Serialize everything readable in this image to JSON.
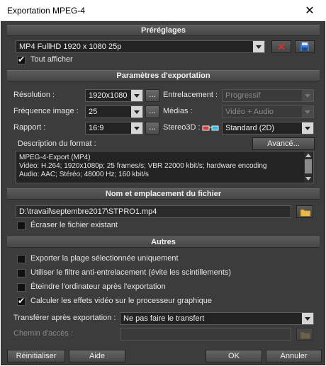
{
  "window": {
    "title": "Exportation MPEG-4",
    "close_glyph": "✕"
  },
  "presets": {
    "header": "Préréglages",
    "selected": "MP4 FullHD 1920 x 1080 25p",
    "show_all_label": "Tout afficher",
    "show_all_checked": true
  },
  "export_params": {
    "header": "Paramètres d'exportation",
    "resolution_label": "Résolution :",
    "resolution_value": "1920x1080",
    "framerate_label": "Fréquence image :",
    "framerate_value": "25",
    "ratio_label": "Rapport :",
    "ratio_value": "16:9",
    "interlace_label": "Entrelacement :",
    "interlace_value": "Progressif",
    "media_label": "Médias :",
    "media_value": "Vidéo + Audio",
    "stereo_label": "Stereo3D :",
    "stereo_value": "Standard (2D)",
    "more_glyph": "...",
    "format_desc_label": "Description du format :",
    "advanced_label": "Avancé...",
    "format_desc_lines": [
      "MPEG-4-Export (MP4)",
      "Video: H.264; 1920x1080p; 25 frames/s; VBR 22000 kbit/s; hardware encoding",
      "Audio: AAC; Stéréo; 48000 Hz; 160 kbit/s"
    ]
  },
  "file": {
    "header": "Nom et emplacement du fichier",
    "path": "D:\\travail\\septembre2017\\STPRO1.mp4",
    "overwrite_label": "Écraser le fichier existant",
    "overwrite_checked": false
  },
  "other": {
    "header": "Autres",
    "options": [
      {
        "label": "Exporter la plage sélectionnée uniquement",
        "checked": false
      },
      {
        "label": "Utiliser le filtre anti-entrelacement (évite les scintillements)",
        "checked": false
      },
      {
        "label": "Éteindre l'ordinateur après l'exportation",
        "checked": false
      },
      {
        "label": "Calculer les effets vidéo sur le processeur graphique",
        "checked": true
      }
    ],
    "transfer_label": "Transférer après exportation :",
    "transfer_value": "Ne pas faire le transfert",
    "access_path_label": "Chemin d'accès :",
    "access_path_value": ""
  },
  "footer": {
    "reset_label": "Réinitialiser",
    "help_label": "Aide",
    "ok_label": "OK",
    "cancel_label": "Annuler"
  },
  "colors": {
    "panel_bg": "#3c3c3c",
    "field_bg": "#232323",
    "folder_icon": "#e8b84a",
    "delete_icon": "#d03030",
    "save_icon": "#3a7bd5"
  }
}
